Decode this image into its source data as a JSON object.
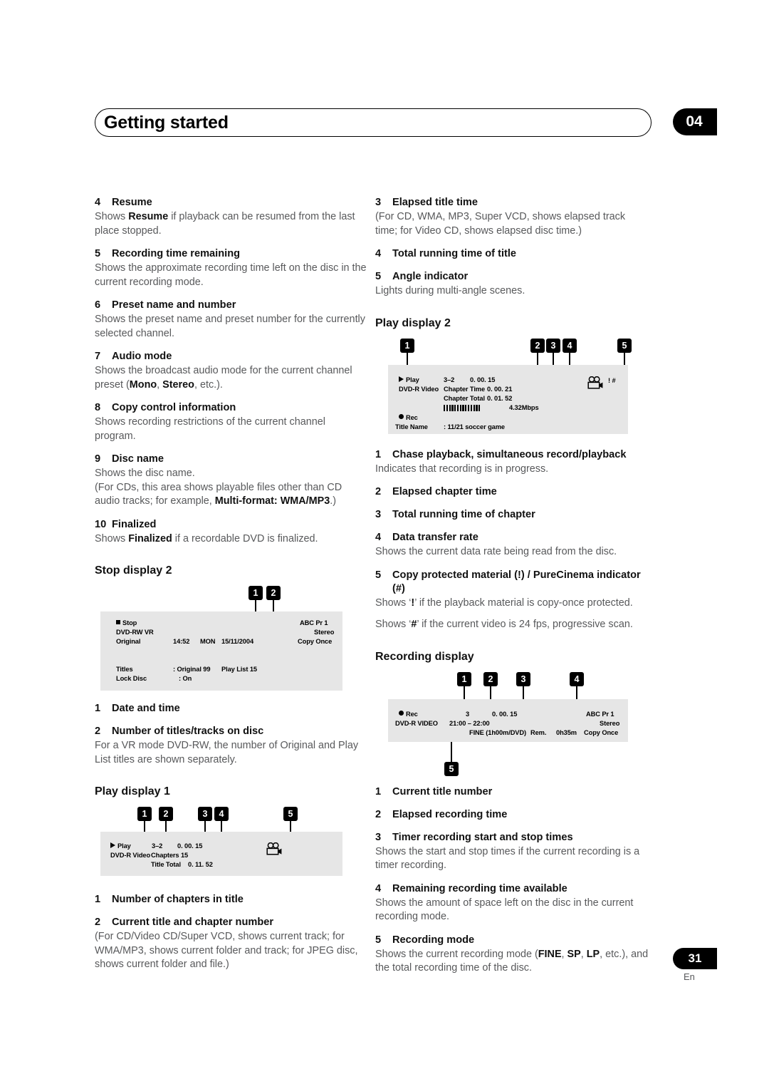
{
  "header": {
    "title": "Getting started",
    "chapter": "04"
  },
  "footer": {
    "page": "31",
    "language": "En"
  },
  "left_column": {
    "items": [
      {
        "num": "4",
        "title": "Resume",
        "body_pre": "Shows ",
        "body_bold": "Resume",
        "body_post": " if playback can be resumed from the last place stopped."
      },
      {
        "num": "5",
        "title": "Recording time remaining",
        "body": "Shows the approximate recording time left on the disc in the current recording mode."
      },
      {
        "num": "6",
        "title": "Preset name and number",
        "body": "Shows the preset name and preset number for the currently selected channel."
      },
      {
        "num": "7",
        "title": "Audio mode",
        "body_pre": "Shows the broadcast audio mode for the current channel preset (",
        "body_bold": "Mono",
        "body_mid": ", ",
        "body_bold2": "Stereo",
        "body_post": ", etc.)."
      },
      {
        "num": "8",
        "title": "Copy control information",
        "body": "Shows recording restrictions of the current channel program."
      },
      {
        "num": "9",
        "title": "Disc name",
        "body": "Shows the disc name.",
        "body2_pre": "(For CDs, this area shows playable files other than CD audio tracks; for example, ",
        "body2_bold": "Multi-format: WMA/MP3",
        "body2_post": ".)"
      },
      {
        "num": "10",
        "title": "Finalized",
        "body_pre": "Shows ",
        "body_bold": "Finalized",
        "body_post": " if a recordable DVD is finalized."
      }
    ],
    "stop_display_heading": "Stop display 2",
    "stop_display_panel": {
      "callouts": [
        "1",
        "2"
      ],
      "line1_status": "Stop",
      "line2_disc": "DVD-RW  VR",
      "line3_mode": "Original",
      "time": "14:52",
      "day": "MON",
      "date": "15/11/2004",
      "preset": "ABC Pr 1",
      "audio": "Stereo",
      "copy": "Copy Once",
      "titles_label": "Titles",
      "titles_value": ": Original  99",
      "playlist_label": "Play List  15",
      "lock_label": "Lock Disc",
      "lock_value": ": On"
    },
    "stop_items": [
      {
        "num": "1",
        "title": "Date and time"
      },
      {
        "num": "2",
        "title": "Number of titles/tracks on disc",
        "body": "For a VR mode DVD-RW, the number of Original and Play List titles are shown separately."
      }
    ],
    "play_display_heading": "Play display 1",
    "play_display_panel": {
      "callouts": [
        "1",
        "2",
        "3",
        "4",
        "5"
      ],
      "status": "Play",
      "disc": "DVD-R   Video",
      "title_chapter": "3–2",
      "elapsed": "0. 00. 15",
      "chapters_label": "Chapters   15",
      "title_total_label": "Title Total",
      "title_total_value": "0. 11. 52",
      "angle_icon": "movie-camera-icon"
    },
    "play_items": [
      {
        "num": "1",
        "title": "Number of chapters in title"
      },
      {
        "num": "2",
        "title": "Current title and chapter number",
        "body": "(For CD/Video CD/Super VCD, shows current track; for WMA/MP3, shows current folder and track; for JPEG disc, shows current folder and file.)"
      }
    ]
  },
  "right_column": {
    "items_top": [
      {
        "num": "3",
        "title": "Elapsed title time",
        "body": "(For CD, WMA, MP3, Super VCD, shows elapsed track time; for Video CD, shows elapsed disc time.)"
      },
      {
        "num": "4",
        "title": "Total running time of title"
      },
      {
        "num": "5",
        "title": "Angle indicator",
        "body": "Lights during multi-angle scenes."
      }
    ],
    "play2_heading": "Play display 2",
    "play2_panel": {
      "callouts": [
        "1",
        "2",
        "3",
        "4",
        "5"
      ],
      "status": "Play",
      "disc": "DVD-R   Video",
      "title_chapter": "3–2",
      "elapsed": "0. 00. 15",
      "chapter_time_label": "Chapter Time",
      "chapter_time_value": "0. 00. 21",
      "chapter_total_label": "Chapter Total",
      "chapter_total_value": "0. 01. 52",
      "bitrate": "4.32Mbps",
      "rec_status": "Rec",
      "title_name_label": "Title Name",
      "title_name_value": ":  11/21 soccer game",
      "indicators": "! #",
      "angle_icon": "movie-camera-icon"
    },
    "play2_items": [
      {
        "num": "1",
        "title": "Chase playback, simultaneous record/playback",
        "body": "Indicates that recording is in progress."
      },
      {
        "num": "2",
        "title": "Elapsed chapter time"
      },
      {
        "num": "3",
        "title": "Total running time of chapter"
      },
      {
        "num": "4",
        "title": "Data transfer rate",
        "body": "Shows the current data rate being read from the disc."
      },
      {
        "num": "5",
        "title": "Copy protected material (!) / PureCinema indicator (#)",
        "body_pre": "Shows ‘",
        "body_bold": "!",
        "body_post": "’ if the playback material is copy-once protected.",
        "body2_pre": "Shows ‘",
        "body2_bold": "#",
        "body2_post": "’ if the current video is 24 fps, progressive scan."
      }
    ],
    "recording_heading": "Recording display",
    "recording_panel": {
      "callouts": [
        "1",
        "2",
        "3",
        "4",
        "5"
      ],
      "rec_status": "Rec",
      "disc": "DVD-R  VIDEO",
      "title_number": "3",
      "elapsed": "0. 00. 15",
      "timer_range": "21:00  –  22:00",
      "mode": "FINE (1h00m/DVD)",
      "rem_label": "Rem.",
      "rem_value": "0h35m",
      "preset": "ABC Pr 1",
      "audio": "Stereo",
      "copy": "Copy Once"
    },
    "recording_items": [
      {
        "num": "1",
        "title": "Current title number"
      },
      {
        "num": "2",
        "title": "Elapsed recording time"
      },
      {
        "num": "3",
        "title": "Timer recording start and stop times",
        "body": "Shows the start and stop times if the current recording is a timer recording."
      },
      {
        "num": "4",
        "title": "Remaining recording time available",
        "body": "Shows the amount of space left on the disc in the current recording mode."
      },
      {
        "num": "5",
        "title": "Recording mode",
        "body_pre": "Shows the current recording mode (",
        "body_bold": "FINE",
        "body_mid": ", ",
        "body_bold2": "SP",
        "body_mid2": ", ",
        "body_bold3": "LP",
        "body_post": ", etc.), and the total recording time of the disc."
      }
    ]
  }
}
